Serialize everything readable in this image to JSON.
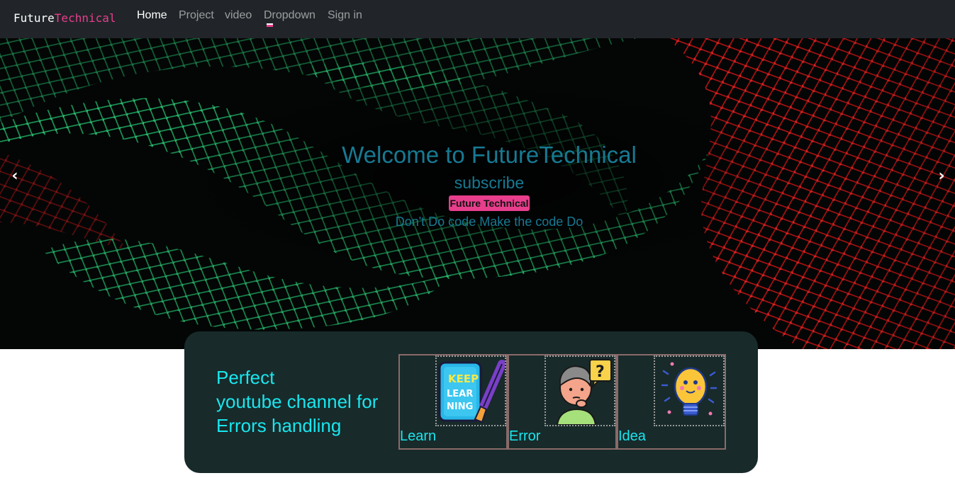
{
  "navbar": {
    "brand_part1": "Future",
    "brand_part2": "Technical",
    "links": [
      {
        "label": "Home",
        "active": true
      },
      {
        "label": "Project"
      },
      {
        "label": "video"
      },
      {
        "label": "Dropdown"
      },
      {
        "label": "Sign in"
      }
    ]
  },
  "carousel": {
    "prev_icon": "‹",
    "next_icon": "›",
    "title": "Welcome to FutureTechnical",
    "subtitle": "subscribe",
    "badge": "Future Technical",
    "tagline": "Don't Do code Make the code Do"
  },
  "feature_panel": {
    "heading": "Perfect\nyoutube channel for\nErrors handling",
    "cards": [
      {
        "label": "Learn",
        "icon": "keep-learning-icon"
      },
      {
        "label": "Error",
        "icon": "thinking-person-icon"
      },
      {
        "label": "Idea",
        "icon": "lightbulb-icon"
      }
    ]
  },
  "colors": {
    "navbar_bg": "#212529",
    "accent_pink": "#e83e8c",
    "caption_teal": "#167a93",
    "panel_bg": "#182a2a",
    "panel_text": "#19e6ee"
  }
}
